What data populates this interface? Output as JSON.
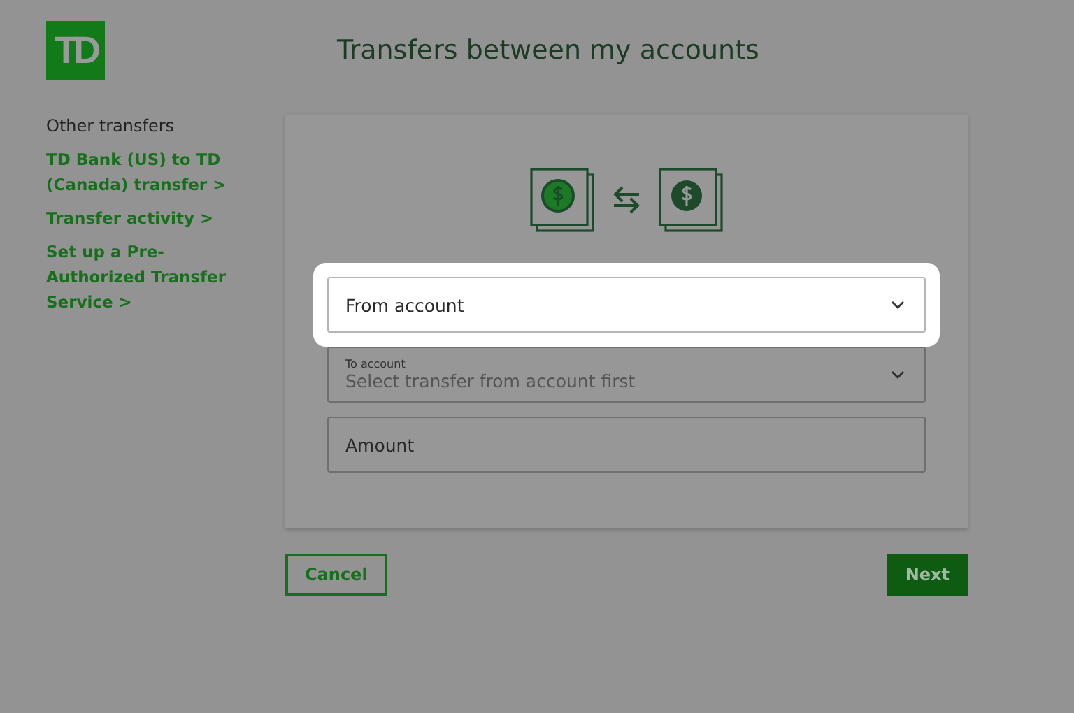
{
  "logo": {
    "text": "TD"
  },
  "title": "Transfers between my accounts",
  "sidebar": {
    "heading": "Other transfers",
    "links": [
      {
        "label": "TD Bank (US) to TD (Canada) transfer",
        "arrow": ">"
      },
      {
        "label": "Transfer activity",
        "arrow": ">"
      },
      {
        "label": "Set up a Pre-Authorized Transfer Service",
        "arrow": ">"
      }
    ]
  },
  "fields": [
    {
      "kind": "select",
      "label": "From account",
      "highlighted": true
    },
    {
      "kind": "select",
      "label": "To account",
      "placeholder": "Select transfer from account first",
      "highlighted": false
    },
    {
      "kind": "input",
      "label": "Amount",
      "highlighted": false
    }
  ],
  "buttons": [
    {
      "label": "Cancel",
      "kind": "secondary"
    },
    {
      "label": "Next",
      "kind": "primary"
    }
  ]
}
